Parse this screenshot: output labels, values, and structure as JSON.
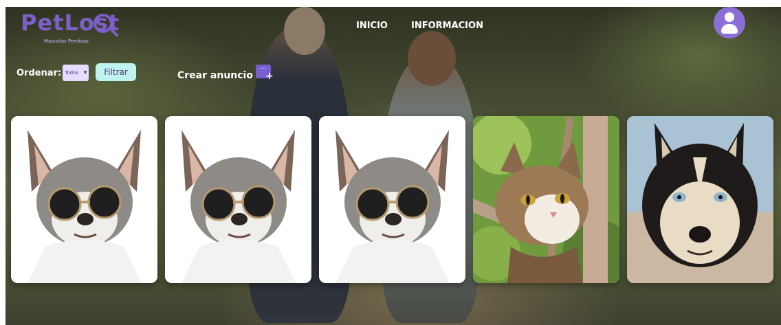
{
  "brand": {
    "name": "PetLost",
    "tagline": "Mascotas Perdidas"
  },
  "nav": {
    "items": [
      "INICIO",
      "INFORMACION"
    ]
  },
  "toolbar": {
    "sort_label": "Ordenar:",
    "sort_value": "Todos",
    "filter_label": "Filtrar",
    "create_label": "Crear anuncio"
  },
  "colors": {
    "brand": "#7c5fc9",
    "filter_bg": "#bff3f0",
    "create_icon_bg": "#7a5fd4"
  },
  "cards": [
    {
      "animal": "chihuahua-sunglasses"
    },
    {
      "animal": "chihuahua-sunglasses"
    },
    {
      "animal": "chihuahua-sunglasses"
    },
    {
      "animal": "tabby-cat"
    },
    {
      "animal": "husky"
    }
  ]
}
